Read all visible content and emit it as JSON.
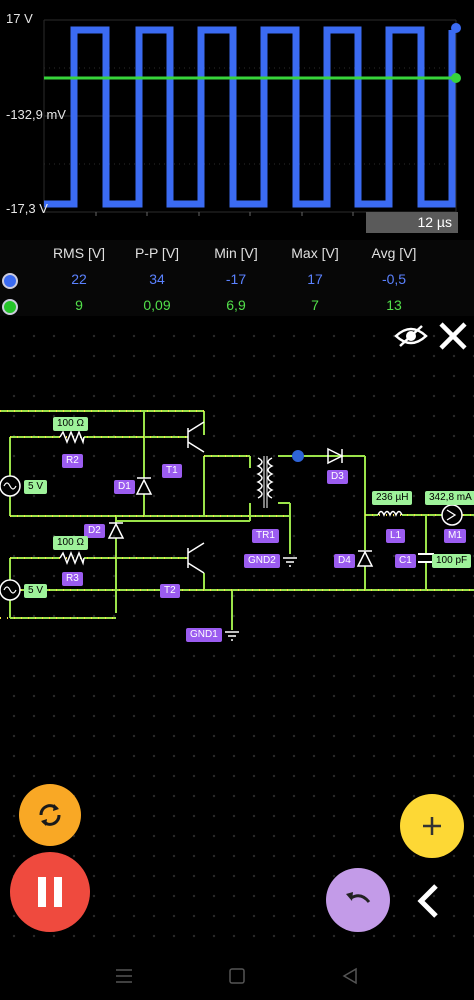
{
  "scope": {
    "y_top_label": "17 V",
    "y_mid_label": "-132,9 mV",
    "y_bottom_label": "-17,3 V",
    "timebase": "12 µs",
    "ch1_color": "#3b6bf2",
    "ch2_color": "#37d43b"
  },
  "measurements": {
    "headers": [
      "RMS [V]",
      "P-P [V]",
      "Min [V]",
      "Max [V]",
      "Avg [V]"
    ],
    "ch1": [
      "22",
      "34",
      "-17",
      "17",
      "-0,5"
    ],
    "ch2": [
      "9",
      "0,09",
      "6,9",
      "7",
      "13"
    ]
  },
  "circuit": {
    "labels": {
      "r2_value": "100 Ω",
      "r2_name": "R2",
      "v1_value": "5 V",
      "d1_name": "D1",
      "t1_name": "T1",
      "d2_name": "D2",
      "r3_value": "100 Ω",
      "r3_name": "R3",
      "v2_value": "5 V",
      "t2_name": "T2",
      "tr1_name": "TR1",
      "gnd2_name": "GND2",
      "gnd1_name": "GND1",
      "d3_name": "D3",
      "d4_name": "D4",
      "l1_value": "236 µH",
      "l1_name": "L1",
      "c1_name": "C1",
      "c1_value": "100 pF",
      "m1_value": "342,8 mA",
      "m1_name": "M1"
    }
  },
  "icons": {
    "visibility": "eye-off-icon",
    "close": "close-icon",
    "reset": "refresh-icon",
    "pause": "pause-icon",
    "add": "plus-icon",
    "undo": "undo-icon",
    "back": "chevron-left-icon"
  }
}
